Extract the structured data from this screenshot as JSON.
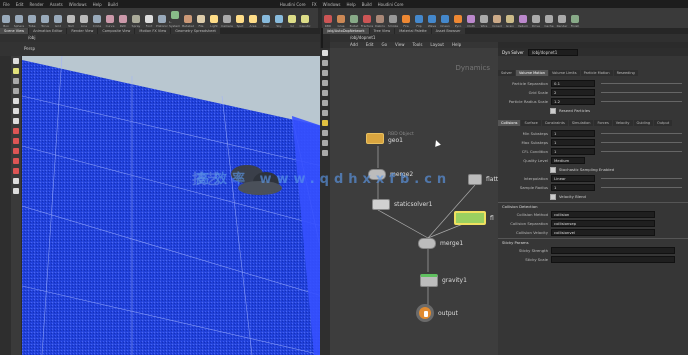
{
  "menubar": [
    "File",
    "Edit",
    "Render",
    "Assets",
    "Windows",
    "Help",
    "Build",
    "Houdini Core",
    "FX",
    "Windows",
    "Help",
    "Build",
    "Houdini Core"
  ],
  "shelf_left": [
    {
      "label": "Box",
      "color": "#9ab"
    },
    {
      "label": "Sphere",
      "color": "#9ab"
    },
    {
      "label": "Tube",
      "color": "#9ab"
    },
    {
      "label": "Torus",
      "color": "#9ab"
    },
    {
      "label": "Grid",
      "color": "#9ab"
    },
    {
      "label": "Null",
      "color": "#bbb"
    },
    {
      "label": "Line",
      "color": "#bbb"
    },
    {
      "label": "Circle",
      "color": "#9ab"
    },
    {
      "label": "Curve",
      "color": "#c9a"
    },
    {
      "label": "Path",
      "color": "#c9a"
    },
    {
      "label": "Spray",
      "color": "#aa9"
    },
    {
      "label": "Font",
      "color": "#ddd"
    },
    {
      "label": "Platonic",
      "color": "#9ab"
    },
    {
      "label": "L-System",
      "color": "#8b8"
    },
    {
      "label": "Metaball",
      "color": "#c97"
    },
    {
      "label": "File",
      "color": "#dca"
    },
    {
      "label": "Light",
      "color": "#fd8"
    },
    {
      "label": "Camera",
      "color": "#aaa"
    },
    {
      "label": "Spot",
      "color": "#fd8"
    },
    {
      "label": "Area",
      "color": "#fd8"
    },
    {
      "label": "Env",
      "color": "#8bd"
    },
    {
      "label": "Sky",
      "color": "#8bd"
    },
    {
      "label": "GI",
      "color": "#dd8"
    },
    {
      "label": "Caustic",
      "color": "#dd8"
    }
  ],
  "shelf_right": [
    {
      "label": "RBD",
      "color": "#c55"
    },
    {
      "label": "Glue",
      "color": "#c85"
    },
    {
      "label": "Bullet",
      "color": "#8a8"
    },
    {
      "label": "Fracture",
      "color": "#c55"
    },
    {
      "label": "Debris",
      "color": "#a87"
    },
    {
      "label": "Smoke",
      "color": "#999"
    },
    {
      "label": "Fire",
      "color": "#e83"
    },
    {
      "label": "Flip",
      "color": "#48c"
    },
    {
      "label": "Wave",
      "color": "#48c"
    },
    {
      "label": "Ocean",
      "color": "#48c"
    },
    {
      "label": "Pyro",
      "color": "#e83"
    },
    {
      "label": "Cloth",
      "color": "#b8c"
    },
    {
      "label": "Wire",
      "color": "#aaa"
    },
    {
      "label": "Crowd",
      "color": "#ca8"
    },
    {
      "label": "Grain",
      "color": "#cb8"
    },
    {
      "label": "Vellum",
      "color": "#b8c"
    },
    {
      "label": "Drive",
      "color": "#aaa"
    },
    {
      "label": "Cache",
      "color": "#aaa"
    },
    {
      "label": "Render",
      "color": "#aaa"
    },
    {
      "label": "Finish",
      "color": "#8a8"
    }
  ],
  "left_tabs": [
    "Scene View",
    "Animation Editor",
    "Render View",
    "Composite View",
    "Motion FX View",
    "Geometry Spreadsheet"
  ],
  "left_path": "/obj",
  "viewport_header": "Persp",
  "right_tabs": [
    "/obj/AutoDopNetwork",
    "Tree View",
    "Material Palette",
    "Asset Browser"
  ],
  "net_path": "/obj/dopnet1",
  "net_menu": [
    "Add",
    "Edit",
    "Go",
    "View",
    "Tools",
    "Layout",
    "Help"
  ],
  "net_label": "Dynamics",
  "nodes": {
    "rbd": {
      "label": "geo1",
      "sub": "RBD Object"
    },
    "merge2": "merge2",
    "solver": "staticsolver1",
    "flatten": "flattar",
    "fluid": "fl",
    "merge1": "merge1",
    "gravity": "gravity1",
    "output": "output"
  },
  "params": {
    "header_type": "Dyn Solver",
    "header_name": "/obj/dopnet1",
    "tabs1": [
      "Solver",
      "Volume Motion",
      "Volume Limits",
      "Particle Motion",
      "Reseeding"
    ],
    "tabs2": [
      "Collisions",
      "Surface",
      "Constraints",
      "Simulation",
      "Forces",
      "Velocity",
      "Guiding",
      "Output"
    ],
    "rows_top": [
      {
        "label": "Particle Separation",
        "value": "0.1"
      },
      {
        "label": "Grid Scale",
        "value": "2"
      },
      {
        "label": "Particle Radius Scale",
        "value": "1.2"
      }
    ],
    "check1": "Reseed Particles",
    "rows_mid": [
      {
        "label": "Min Substeps",
        "value": "1"
      },
      {
        "label": "Max Substeps",
        "value": "1"
      },
      {
        "label": "CFL Condition",
        "value": "1"
      },
      {
        "label": "Quality Level",
        "value": "Medium"
      }
    ],
    "check2": "Stochastic Sampling Enabled",
    "rows_low": [
      {
        "label": "Interpolation",
        "value": "Linear"
      },
      {
        "label": "Sample Radius",
        "value": "1"
      }
    ],
    "check3": "Velocity Blend",
    "group1": "Collision Detection",
    "fields": [
      {
        "label": "Collision Method",
        "value": "collision"
      },
      {
        "label": "Collision Separation",
        "value": "collisionsep"
      },
      {
        "label": "Collision Velocity",
        "value": "collisionvel"
      }
    ],
    "group2": "Sticky Params",
    "rows_end": [
      {
        "label": "Sticky Strength",
        "value": ""
      },
      {
        "label": "Sticky Scale",
        "value": ""
      }
    ]
  },
  "watermark": "高效率 www.qdhxxfb.cn",
  "colors": {
    "water": "#1f3fd8",
    "accent": "#e8b040",
    "select": "#4a7fd0"
  }
}
